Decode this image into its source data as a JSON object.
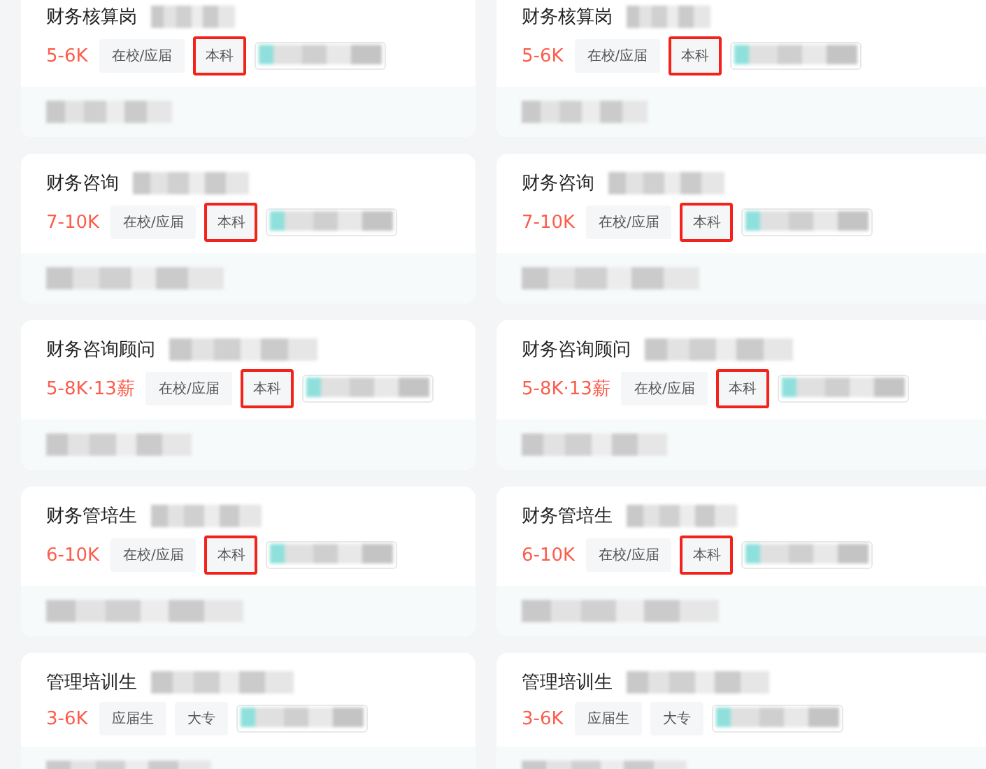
{
  "columns": [
    {
      "cards": [
        {
          "title": "财务核算岗",
          "salary": "5-6K",
          "tags": [
            {
              "label": "在校/应届",
              "highlighted": false
            },
            {
              "label": "本科",
              "highlighted": true
            }
          ]
        },
        {
          "title": "财务咨询",
          "salary": "7-10K",
          "tags": [
            {
              "label": "在校/应届",
              "highlighted": false
            },
            {
              "label": "本科",
              "highlighted": true
            }
          ]
        },
        {
          "title": "财务咨询顾问",
          "salary": "5-8K·13薪",
          "tags": [
            {
              "label": "在校/应届",
              "highlighted": false
            },
            {
              "label": "本科",
              "highlighted": true
            }
          ]
        },
        {
          "title": "财务管培生",
          "salary": "6-10K",
          "tags": [
            {
              "label": "在校/应届",
              "highlighted": false
            },
            {
              "label": "本科",
              "highlighted": true
            }
          ]
        },
        {
          "title": "管理培训生",
          "salary": "3-6K",
          "tags": [
            {
              "label": "应届生",
              "highlighted": false
            },
            {
              "label": "大专",
              "highlighted": false
            }
          ]
        }
      ]
    },
    {
      "cards": [
        {
          "title": "财务核算岗",
          "salary": "5-6K",
          "tags": [
            {
              "label": "在校/应届",
              "highlighted": false
            },
            {
              "label": "本科",
              "highlighted": true
            }
          ]
        },
        {
          "title": "财务咨询",
          "salary": "7-10K",
          "tags": [
            {
              "label": "在校/应届",
              "highlighted": false
            },
            {
              "label": "本科",
              "highlighted": true
            }
          ]
        },
        {
          "title": "财务咨询顾问",
          "salary": "5-8K·13薪",
          "tags": [
            {
              "label": "在校/应届",
              "highlighted": false
            },
            {
              "label": "本科",
              "highlighted": true
            }
          ]
        },
        {
          "title": "财务管培生",
          "salary": "6-10K",
          "tags": [
            {
              "label": "在校/应届",
              "highlighted": false
            },
            {
              "label": "本科",
              "highlighted": true
            }
          ]
        },
        {
          "title": "管理培训生",
          "salary": "3-6K",
          "tags": [
            {
              "label": "应届生",
              "highlighted": false
            },
            {
              "label": "大专",
              "highlighted": false
            }
          ]
        }
      ]
    }
  ]
}
